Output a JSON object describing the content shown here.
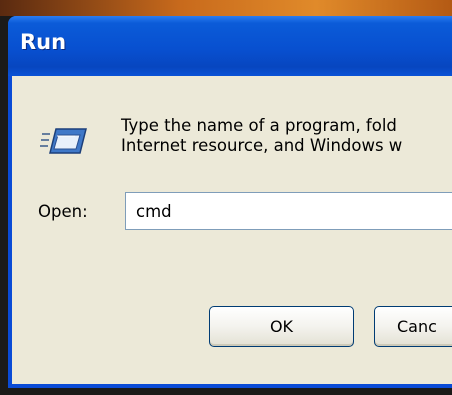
{
  "window": {
    "title": "Run"
  },
  "dialog": {
    "instructions": [
      "Type the name of a program, fold",
      "Internet resource, and Windows w"
    ],
    "open_label": "Open:",
    "open_value": "cmd"
  },
  "buttons": {
    "ok": "OK",
    "cancel": "Canc"
  },
  "icons": {
    "run": "run-dialog-icon"
  },
  "colors": {
    "titlebar": "#0850d0",
    "client": "#ece9d8",
    "input_border": "#7f9db9",
    "button_border": "#003c74"
  }
}
